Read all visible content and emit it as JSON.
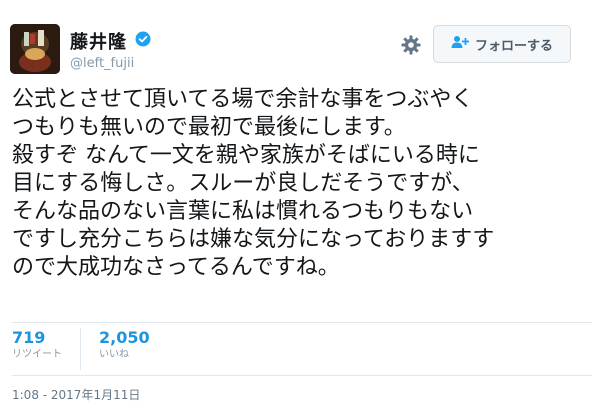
{
  "user": {
    "display_name": "藤井隆",
    "handle": "@left_fujii",
    "verified": true
  },
  "actions": {
    "follow_label": "フォローする"
  },
  "icons": {
    "avatar": "profile-photo",
    "verified": "verified-badge-icon",
    "settings": "gear-icon",
    "follow": "person-plus-icon"
  },
  "colors": {
    "verified": "#1da1f2",
    "stat_value": "#1b95e0",
    "muted": "#8899a6",
    "text": "#14171a"
  },
  "tweet": {
    "lines": [
      "公式とさせて頂いてる場で余計な事をつぶやく",
      "つもりも無いので最初で最後にします。",
      "殺すぞ なんて一文を親や家族がそばにいる時に",
      "目にする悔しさ。スルーが良しだそうですが、",
      "そんな品のない言葉に私は慣れるつもりもない",
      "ですし充分こちらは嫌な気分になっておりますす",
      "ので大成功なさってるんですね。"
    ]
  },
  "stats": {
    "retweets": {
      "value": "719",
      "label": "リツイート"
    },
    "likes": {
      "value": "2,050",
      "label": "いいね"
    }
  },
  "timestamp": "1:08 - 2017年1月11日"
}
